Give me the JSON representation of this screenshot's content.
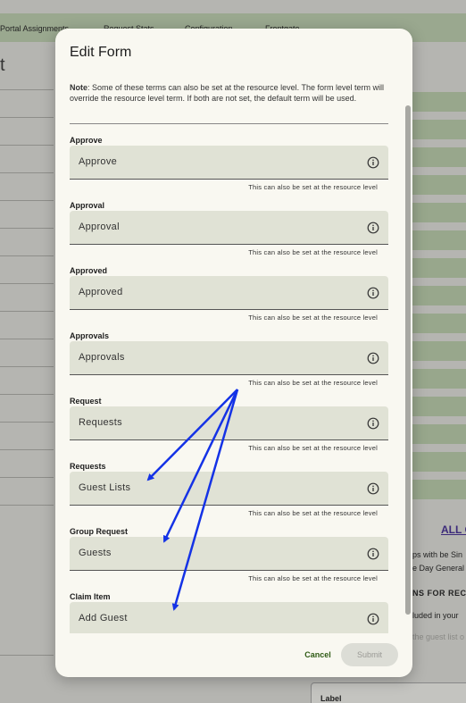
{
  "background": {
    "nav_items": [
      "Portal Assignments",
      "Request Stats",
      "Configuration",
      "Frontgate"
    ],
    "title_fragment": "t",
    "link_all": "ALL C",
    "text_1": "ps with be Sin",
    "text_2": "e Day General",
    "text_3": "NS FOR RECE",
    "text_4": "luded in your",
    "text_5": "the guest list o",
    "card_label": "Label"
  },
  "modal": {
    "title": "Edit Form",
    "note_prefix": "Note",
    "note_text": ": Some of these terms can also be set at the resource level. The form level term will override the resource level term. If both are not set, the default term will be used.",
    "help_text": "This can also be set at the resource level",
    "fields": [
      {
        "label": "Approve",
        "value": "Approve"
      },
      {
        "label": "Approval",
        "value": "Approval"
      },
      {
        "label": "Approved",
        "value": "Approved"
      },
      {
        "label": "Approvals",
        "value": "Approvals"
      },
      {
        "label": "Request",
        "value": "Requests"
      },
      {
        "label": "Requests",
        "value": "Guest Lists"
      },
      {
        "label": "Group Request",
        "value": "Guests"
      },
      {
        "label": "Claim Item",
        "value": "Add Guest"
      }
    ],
    "cancel_label": "Cancel",
    "submit_label": "Submit"
  },
  "colors": {
    "arrow": "#1432e6",
    "field_bg": "#e0e2d5",
    "modal_bg": "#f9f8f1",
    "cancel_text": "#2e5a14"
  },
  "icons": {
    "field_info": "info-icon"
  }
}
